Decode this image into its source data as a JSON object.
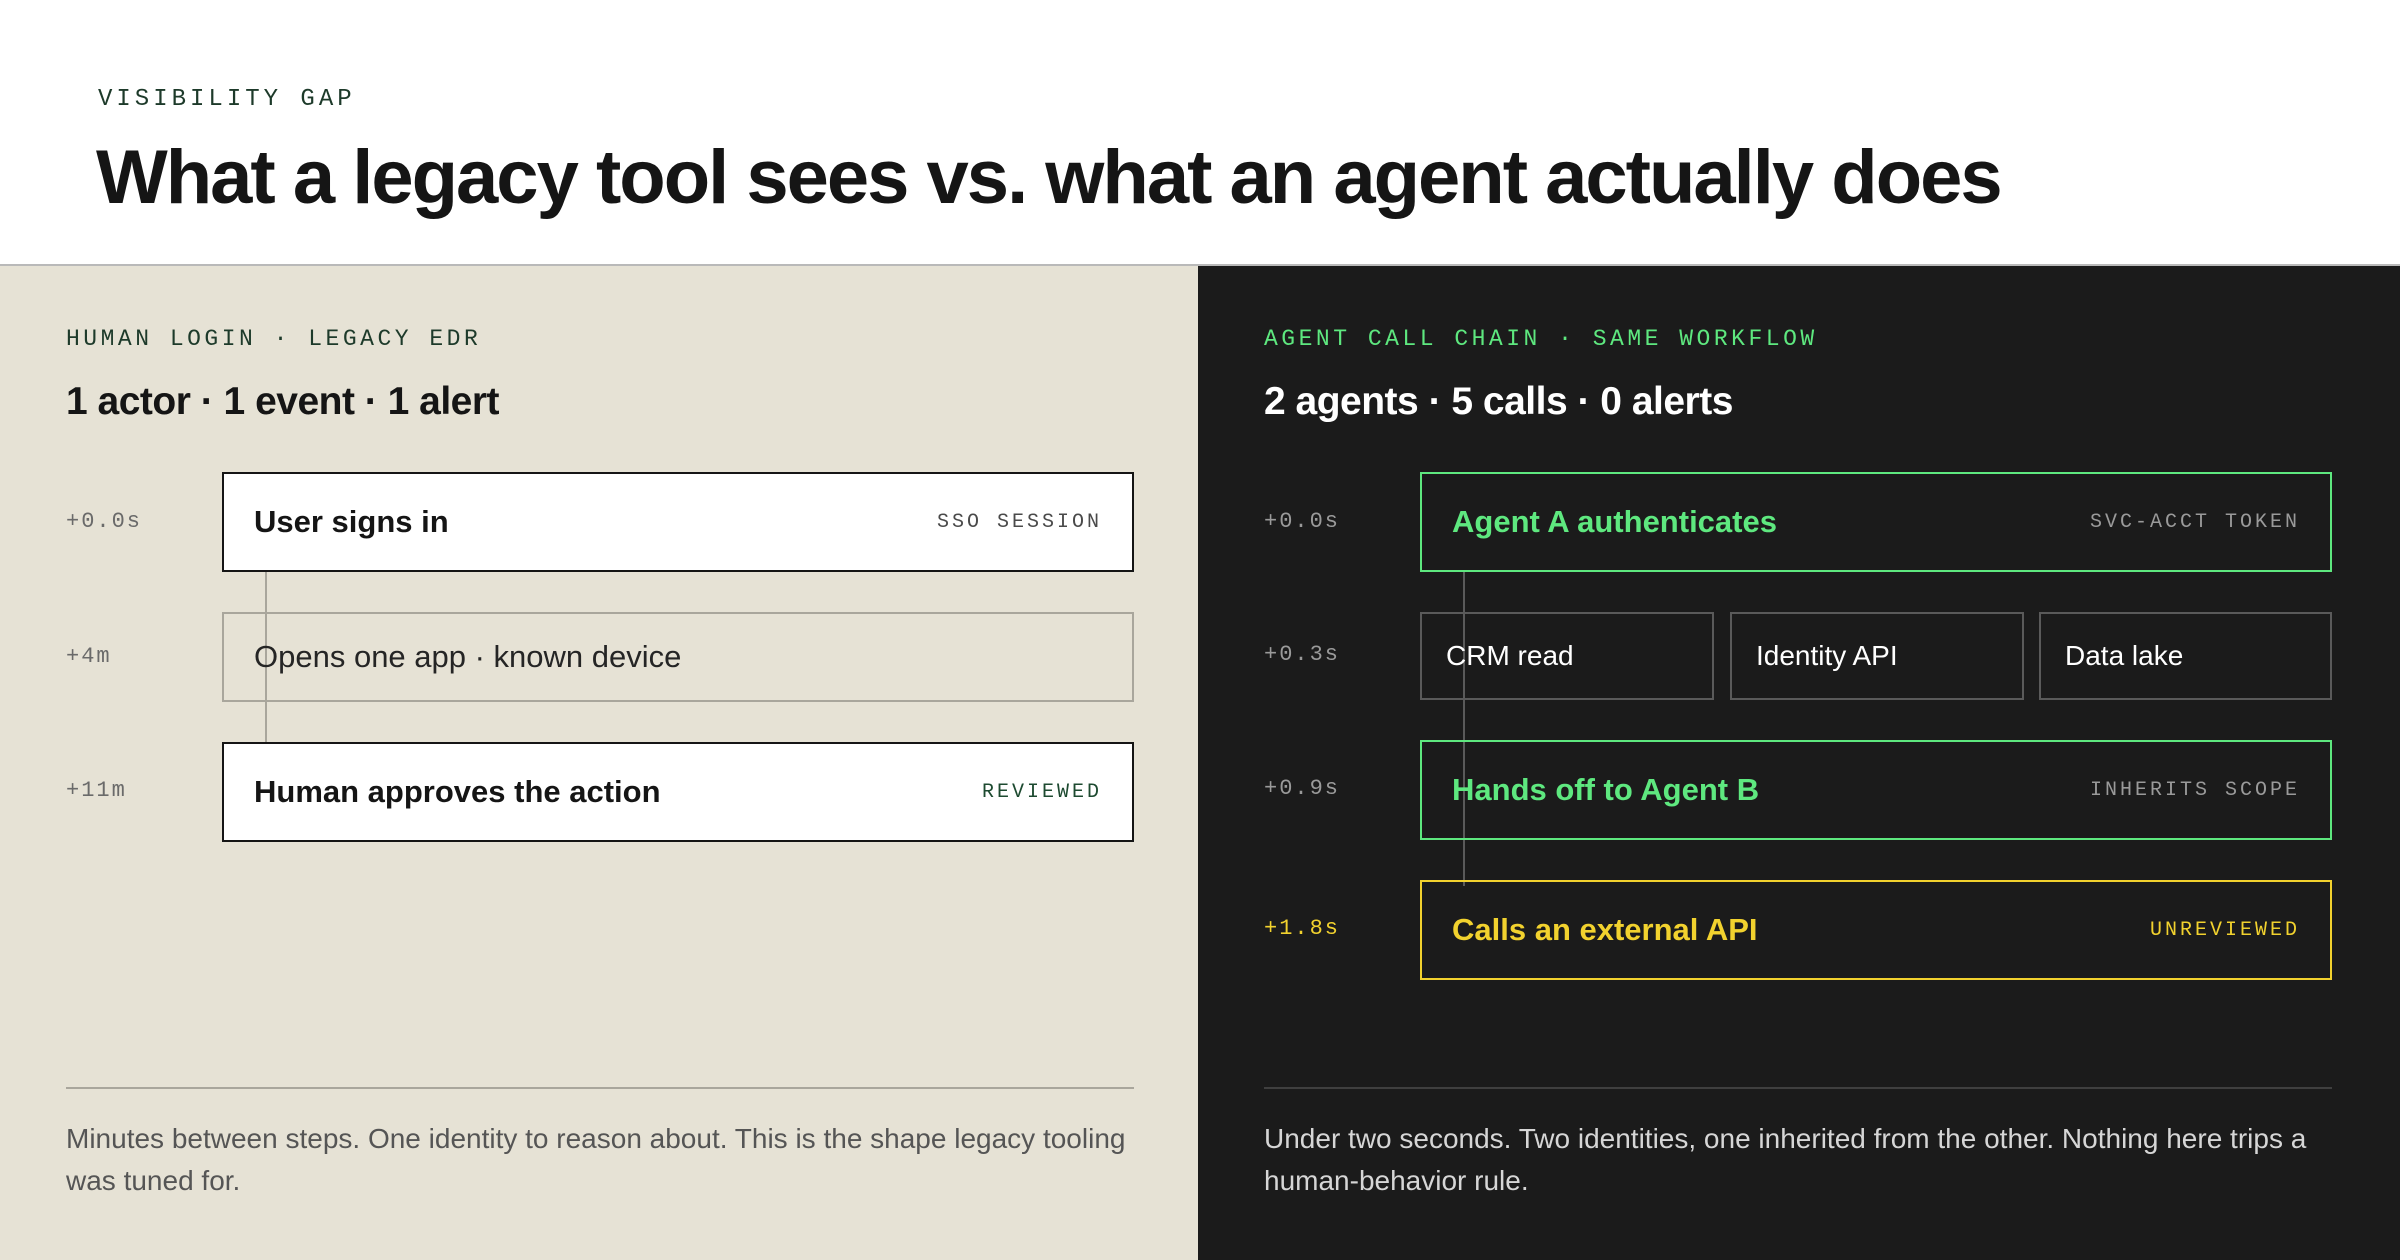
{
  "header": {
    "eyebrow": "VISIBILITY GAP",
    "title": "What a legacy tool sees vs. what an agent actually does"
  },
  "left": {
    "eyebrow": "HUMAN LOGIN · LEGACY EDR",
    "stat": "1 actor · 1 event · 1 alert",
    "steps": [
      {
        "time": "+0.0s",
        "label": "User signs in",
        "tag": "SSO SESSION"
      },
      {
        "time": "+4m",
        "label": "Opens one app · known device",
        "tag": ""
      },
      {
        "time": "+11m",
        "label": "Human approves the action",
        "tag": "REVIEWED"
      }
    ],
    "footnote": "Minutes between steps. One identity to reason about. This is the shape legacy tooling was tuned for."
  },
  "right": {
    "eyebrow": "AGENT CALL CHAIN · SAME WORKFLOW",
    "stat": "2 agents · 5 calls · 0 alerts",
    "steps": [
      {
        "time": "+0.0s",
        "label": "Agent A authenticates",
        "tag": "SVC-ACCT TOKEN"
      },
      {
        "time": "+0.3s",
        "calls": [
          "CRM read",
          "Identity API",
          "Data lake"
        ]
      },
      {
        "time": "+0.9s",
        "label": "Hands off to Agent B",
        "tag": "INHERITS SCOPE"
      },
      {
        "time": "+1.8s",
        "label": "Calls an external API",
        "tag": "UNREVIEWED"
      }
    ],
    "footnote": "Under two seconds. Two identities, one inherited from the other. Nothing here trips a human-behavior rule."
  },
  "colors": {
    "left_bg": "#e6e2d5",
    "right_bg": "#1b1b1b",
    "accent_green": "#5ee87f",
    "accent_yellow": "#f2d22e",
    "ink": "#151515"
  }
}
